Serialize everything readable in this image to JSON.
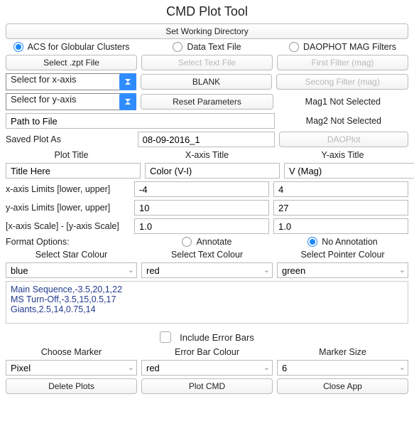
{
  "title": "CMD Plot Tool",
  "setwd": "Set Working Directory",
  "mode": {
    "acs": "ACS for Globular Clusters",
    "datatext": "Data Text File",
    "daophot": "DAOPHOT MAG Filters"
  },
  "row_selectfile": {
    "zpt": "Select .zpt File",
    "textfile": "Select Text File",
    "firstfilter": "First Filter (mag)"
  },
  "row_xaxis": {
    "x": "Select for x-axis",
    "blank": "BLANK",
    "second": "Secong Filter (mag)"
  },
  "row_yaxis": {
    "y": "Select for y-axis",
    "reset": "Reset Parameters",
    "mag1": "Mag1 Not Selected"
  },
  "row_path": {
    "path": "Path to File",
    "mag2": "Mag2 Not Selected"
  },
  "row_saved": {
    "label": "Saved Plot As",
    "value": "08-09-2016_1",
    "daoplot": "DAOPlot"
  },
  "headers_titles": {
    "plot": "Plot Title",
    "x": "X-axis Title",
    "y": "Y-axis Title"
  },
  "titles": {
    "plot": "Title Here",
    "x": "Color (V-I)",
    "y": "V (Mag)"
  },
  "xlim": {
    "label": "x-axis Limits [lower, upper]",
    "low": "-4",
    "high": "4"
  },
  "ylim": {
    "label": "y-axis Limits [lower, upper]",
    "low": "10",
    "high": "27"
  },
  "scale": {
    "label": "[x-axis Scale] - [y-axis Scale]",
    "x": "1.0",
    "y": "1.0"
  },
  "format": {
    "label": "Format Options:",
    "annotate": "Annotate",
    "noannotate": "No Annotation"
  },
  "colour_hdr": {
    "star": "Select Star Colour",
    "text": "Select Text Colour",
    "pointer": "Select Pointer Colour"
  },
  "colours": {
    "star": "blue",
    "text": "red",
    "pointer": "green"
  },
  "seqtext": "Main Sequence,-3.5,20,1,22\nMS Turn-Off,-3.5,15,0.5,17\nGiants,2.5,14,0.75,14",
  "errbars": "Include Error Bars",
  "marker_hdr": {
    "marker": "Choose Marker",
    "errcol": "Error Bar Colour",
    "size": "Marker Size"
  },
  "markers": {
    "marker": "Pixel",
    "errcol": "red",
    "size": "6"
  },
  "bottom": {
    "delete": "Delete Plots",
    "plot": "Plot CMD",
    "close": "Close App"
  }
}
